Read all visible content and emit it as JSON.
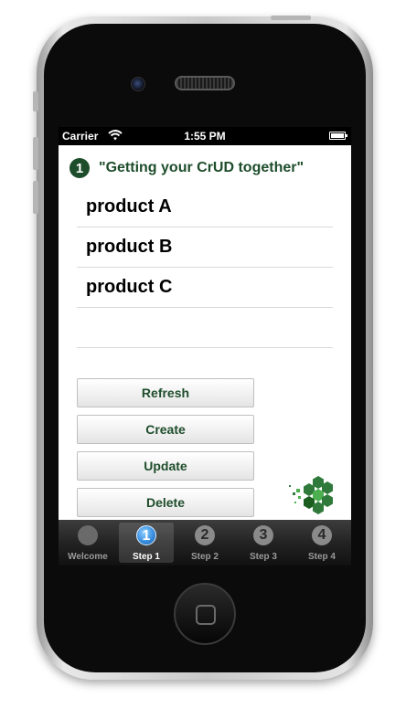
{
  "status_bar": {
    "carrier": "Carrier",
    "time": "1:55 PM"
  },
  "header": {
    "step_number": "1",
    "title": "\"Getting your CrUD together\""
  },
  "products": [
    {
      "name": "product A"
    },
    {
      "name": "product B"
    },
    {
      "name": "product C"
    },
    {
      "name": ""
    }
  ],
  "actions": {
    "refresh": "Refresh",
    "create": "Create",
    "update": "Update",
    "delete": "Delete"
  },
  "tabs": [
    {
      "label": "Welcome",
      "icon": "circle-icon",
      "number": ""
    },
    {
      "label": "Step 1",
      "icon": "number-1-icon",
      "number": "1",
      "selected": true
    },
    {
      "label": "Step 2",
      "icon": "number-2-icon",
      "number": "2"
    },
    {
      "label": "Step 3",
      "icon": "number-3-icon",
      "number": "3"
    },
    {
      "label": "Step 4",
      "icon": "number-4-icon",
      "number": "4"
    }
  ],
  "colors": {
    "accent": "#1e4d2b",
    "tab_selected": "#3a8fe0",
    "logo_green": "#2f7a3a"
  }
}
